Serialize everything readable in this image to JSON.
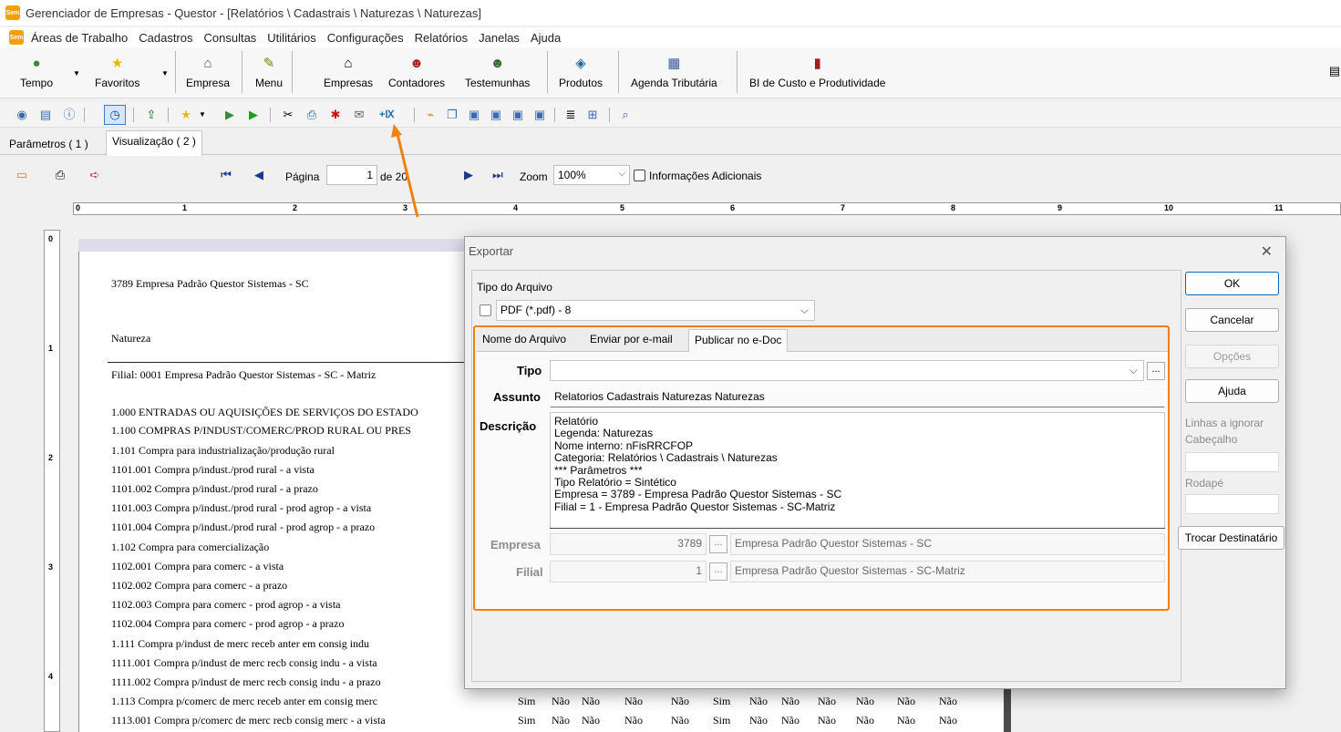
{
  "window": {
    "title": "Gerenciador de Empresas - Questor - [Relatórios \\ Cadastrais \\ Naturezas \\ Naturezas]",
    "app_icon": "Sem"
  },
  "menu": [
    "Áreas de Trabalho",
    "Cadastros",
    "Consultas",
    "Utilitários",
    "Configurações",
    "Relatórios",
    "Janelas",
    "Ajuda"
  ],
  "ribbon": {
    "tempo": "Tempo",
    "favoritos": "Favoritos",
    "empresa": "Empresa",
    "menu": "Menu",
    "empresas": "Empresas",
    "contadores": "Contadores",
    "testemunhas": "Testemunhas",
    "produtos": "Produtos",
    "agenda": "Agenda Tributária",
    "bi": "BI de Custo e Produtividade"
  },
  "tabs": {
    "params": "Parâmetros ( 1 )",
    "view": "Visualização ( 2 )"
  },
  "nav": {
    "page_label": "Página",
    "page_value": "1",
    "of_label": "de 20",
    "zoom_label": "Zoom",
    "zoom_value": "100%",
    "info_label": "Informações Adicionais"
  },
  "ruler": {
    "h": [
      "0",
      "1",
      "2",
      "3",
      "4",
      "5",
      "6",
      "7",
      "8",
      "9",
      "10",
      "11"
    ],
    "v": [
      "0",
      "1",
      "2",
      "3",
      "4"
    ]
  },
  "report": {
    "company": "3789 Empresa Padrão Questor Sistemas - SC",
    "title": "Natureza",
    "filial": "Filial: 0001 Empresa Padrão Questor Sistemas - SC - Matriz",
    "lines": [
      "1.000   ENTRADAS OU AQUISIÇÕES DE SERVIÇOS DO ESTADO",
      "1.100   COMPRAS P/INDUST/COMERC/PROD RURAL OU PRES",
      "1.101   Compra para industrialização/produção rural",
      "1101.001   Compra p/indust./prod rural - a vista",
      "1101.002   Compra p/indust./prod rural - a prazo",
      "1101.003   Compra p/indust./prod rural - prod agrop - a vista",
      "1101.004   Compra p/indust./prod rural - prod agrop - a prazo",
      "1.102   Compra para comercialização",
      "1102.001   Compra para comerc - a vista",
      "1102.002   Compra para comerc - a prazo",
      "1102.003   Compra para comerc - prod agrop - a vista",
      "1102.004   Compra para comerc - prod agrop - a prazo",
      "1.111   Compra p/indust de merc receb anter em consig indu",
      "1111.001   Compra p/indust de merc recb consig indu - a vista",
      "1111.002   Compra p/indust de merc recb consig indu - a prazo",
      "1.113   Compra p/comerc de merc receb anter em consig merc",
      "1113.001   Compra p/comerc de merc recb consig merc - a vista"
    ],
    "yesno_rows": [
      [
        "Sim",
        "Não",
        "Não",
        "Não",
        "Não",
        "Sim",
        "Não",
        "Não",
        "Não",
        "Não",
        "Não",
        "Não"
      ],
      [
        "Sim",
        "Não",
        "Não",
        "Não",
        "Não",
        "Sim",
        "Não",
        "Não",
        "Não",
        "Não",
        "Não",
        "Não"
      ]
    ]
  },
  "dialog": {
    "title": "Exportar",
    "file_type_label": "Tipo do Arquivo",
    "file_type_value": "PDF (*.pdf) - 8",
    "tabs": [
      "Nome do Arquivo",
      "Enviar por e-mail",
      "Publicar no e-Doc"
    ],
    "tipo_label": "Tipo",
    "tipo_value": "",
    "assunto_label": "Assunto",
    "assunto_value": "Relatorios Cadastrais Naturezas Naturezas",
    "descricao_label": "Descrição",
    "descricao_lines": [
      "Relatório",
      "Legenda: Naturezas",
      "Nome interno: nFisRRCFOP",
      "Categoria: Relatórios \\ Cadastrais \\ Naturezas",
      "*** Parâmetros ***",
      "Tipo Relatório = Sintético",
      "Empresa = 3789 - Empresa Padrão Questor Sistemas - SC",
      "Filial = 1 - Empresa Padrão Questor Sistemas - SC-Matriz"
    ],
    "empresa_label": "Empresa",
    "empresa_code": "3789",
    "empresa_name": "Empresa Padrão Questor Sistemas - SC",
    "filial_label": "Filial",
    "filial_code": "1",
    "filial_name": "Empresa Padrão Questor Sistemas - SC-Matriz",
    "ellipsis": "...",
    "buttons": {
      "ok": "OK",
      "cancelar": "Cancelar",
      "opcoes": "Opções",
      "ajuda": "Ajuda",
      "trocar": "Trocar Destinatário"
    },
    "linhas_ignorar": "Linhas a ignorar",
    "cabecalho": "Cabeçalho",
    "rodape": "Rodapé"
  },
  "annotation": {
    "highlight_color": "#f08010",
    "arrow_color": "#f08010"
  }
}
